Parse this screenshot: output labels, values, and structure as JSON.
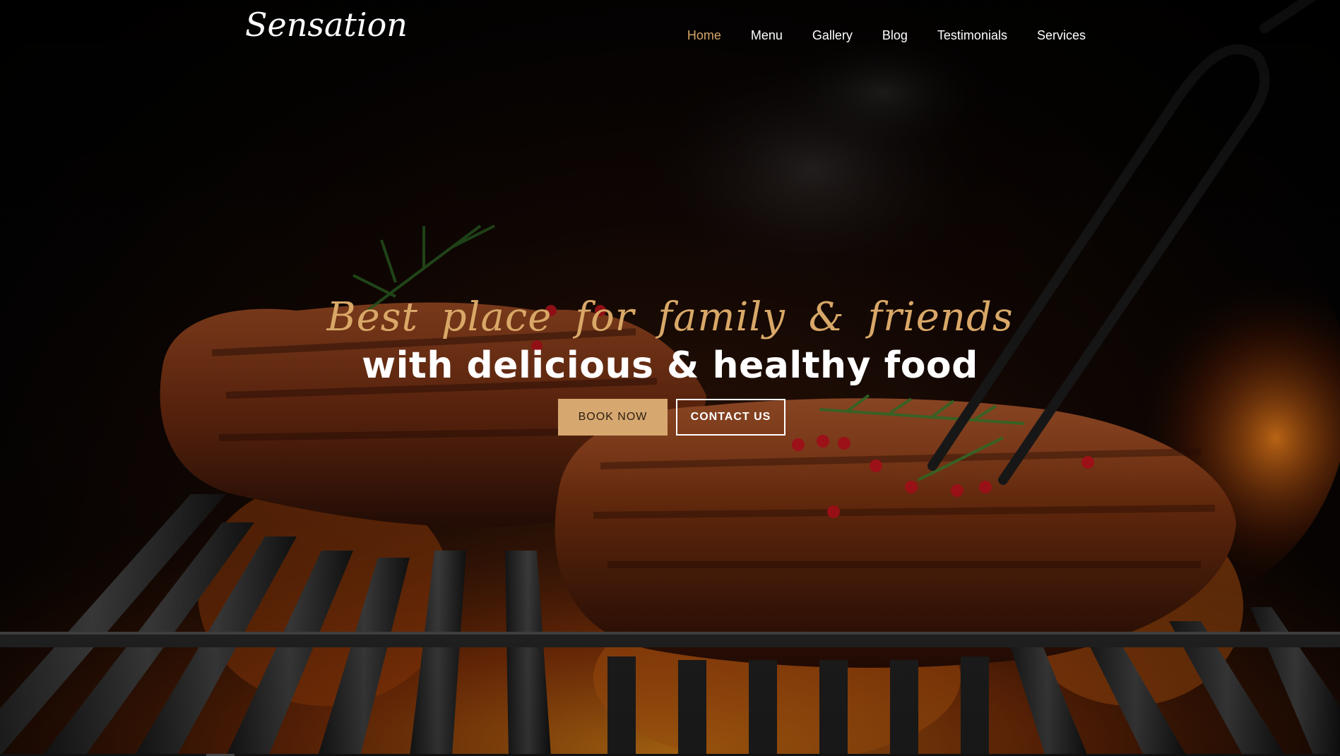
{
  "brand": {
    "logo_text": "Sensation"
  },
  "nav": {
    "items": [
      {
        "label": "Home",
        "active": true
      },
      {
        "label": "Menu",
        "active": false
      },
      {
        "label": "Gallery",
        "active": false
      },
      {
        "label": "Blog",
        "active": false
      },
      {
        "label": "Testimonials",
        "active": false
      },
      {
        "label": "Services",
        "active": false
      }
    ]
  },
  "hero": {
    "tagline": "Best place for family & friends",
    "headline": "with delicious & healthy food",
    "book_button": "BOOK NOW",
    "contact_button": "CONTACT US"
  },
  "colors": {
    "accent": "#d4a46a",
    "text": "#ffffff",
    "background": "#000000"
  },
  "icons": {
    "background_image": "grilled-steak-on-fire-grill"
  }
}
